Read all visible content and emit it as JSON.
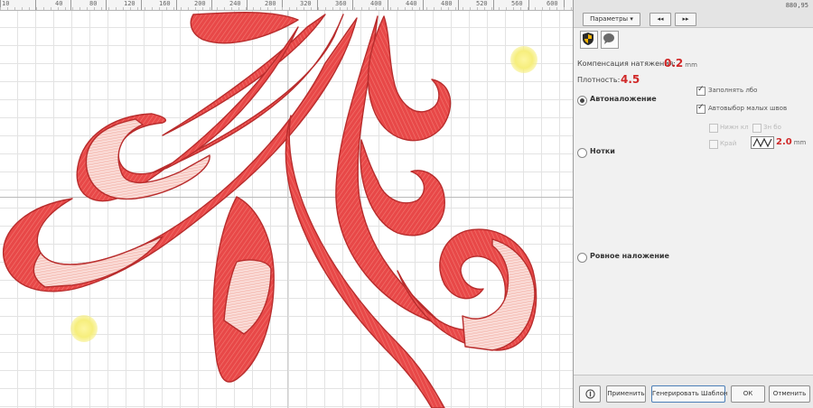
{
  "ruler": {
    "numbers": [
      "10",
      "40",
      "80",
      "120",
      "160",
      "200",
      "240",
      "280",
      "320",
      "360",
      "400",
      "440",
      "480",
      "520",
      "560",
      "600"
    ]
  },
  "toolbar": {
    "params_label": "Параметры",
    "dropdown_icon": "chevron-down-icon",
    "coords_text": "880,95"
  },
  "tabs": [
    {
      "icon": "shield-icon"
    },
    {
      "icon": "speech-bubble-icon"
    }
  ],
  "settings": {
    "compensation_label": "Компенсация натяжения:",
    "compensation_value": "0.2",
    "compensation_unit": "mm",
    "density_label": "Плотность:",
    "density_value": "4.5"
  },
  "fill_modes": [
    {
      "label": "Автоналожение",
      "selected": true
    },
    {
      "label": "Нотки",
      "selected": false
    },
    {
      "label": "Ровное наложение",
      "selected": false
    }
  ],
  "options": {
    "opt1_label": "Заполнять лбо",
    "opt1_checked": true,
    "opt2_label": "Автовыбор малых швов",
    "opt2_checked": true,
    "sub1_label": "Нижн кл",
    "sub2_label": "3н бо",
    "sub3_label": "Край",
    "stitch_length_value": "2.0",
    "stitch_length_unit": "mm"
  },
  "buttons": {
    "apply": "Применить",
    "regenerate": "Генерировать Шаблон",
    "ok": "ОК",
    "cancel": "Отменить"
  },
  "colors": {
    "thread_red": "#e84848",
    "thread_dark": "#b82c2c",
    "thread_highlight": "#fbe4e0",
    "handle_yellow": "#f6ee7c",
    "accent_red_text": "#d02828"
  }
}
